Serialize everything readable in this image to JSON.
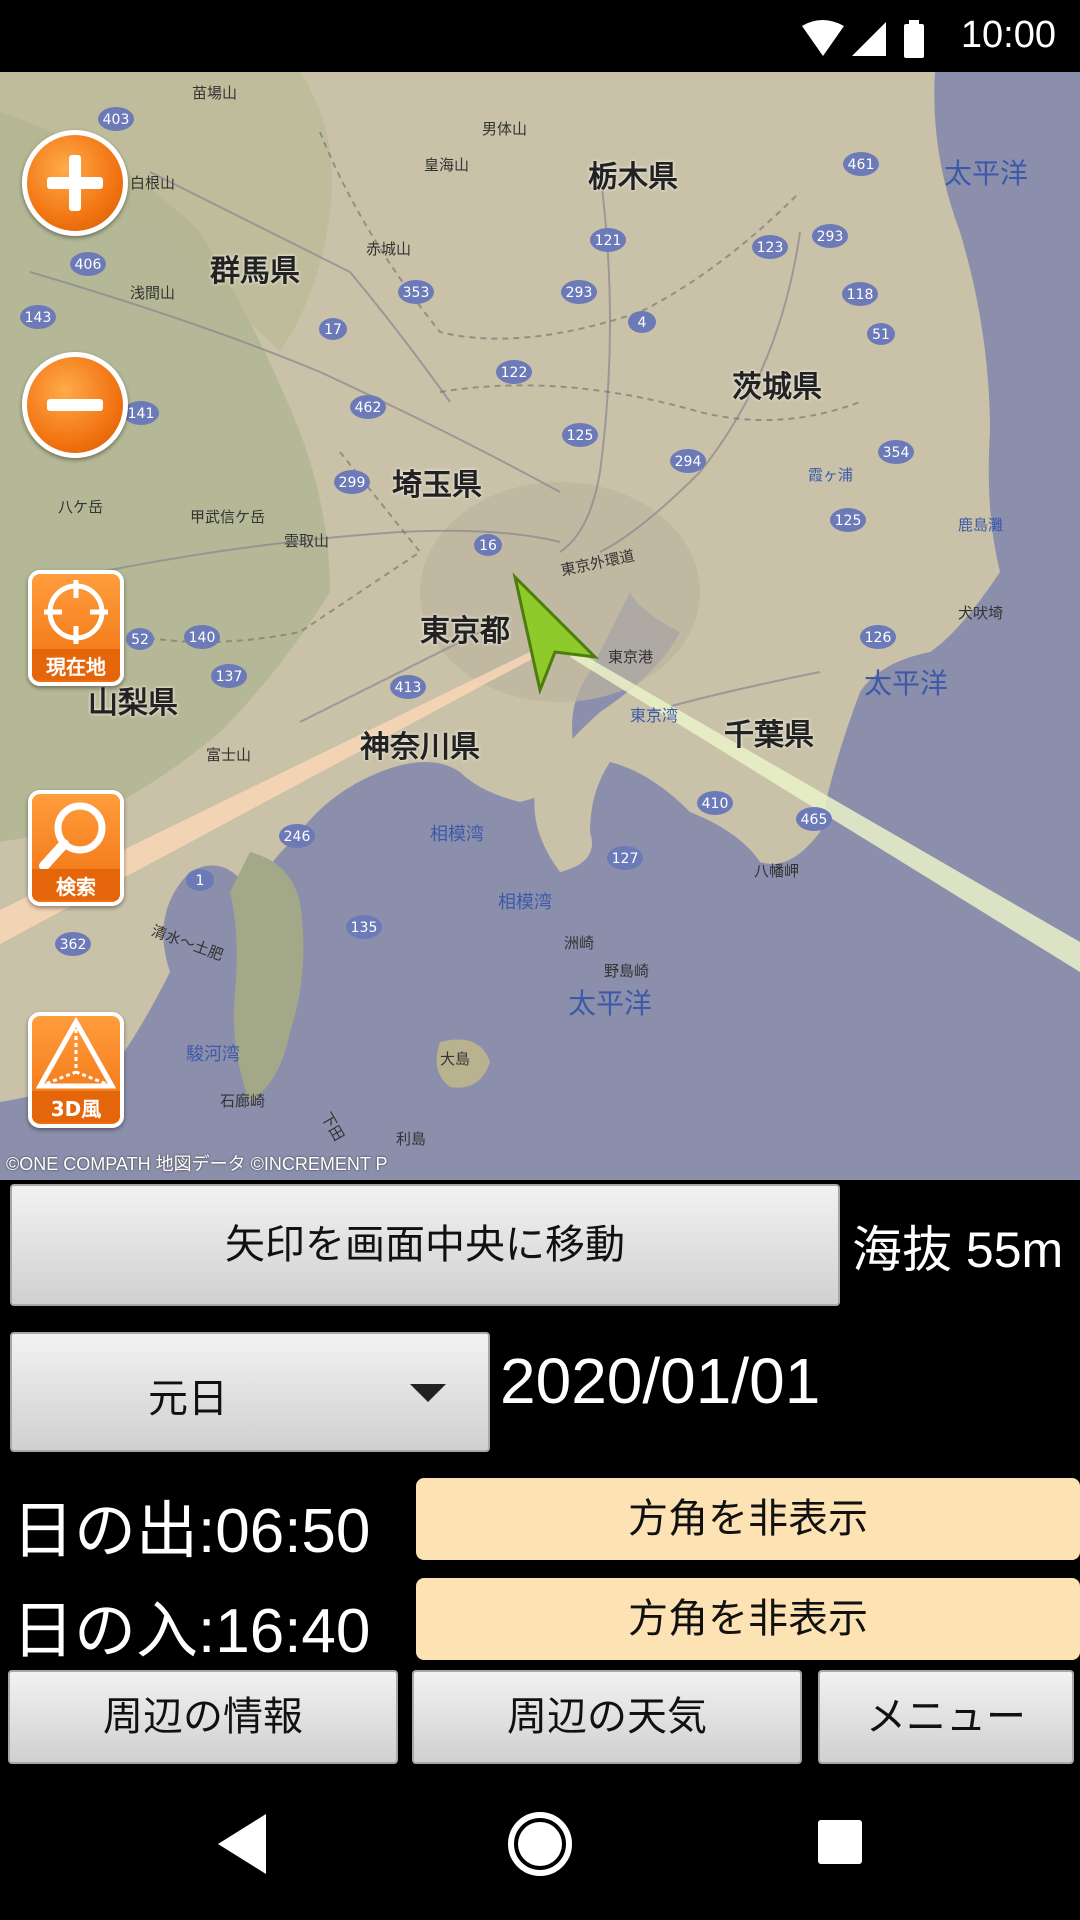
{
  "status_bar": {
    "time": "10:00",
    "icons": [
      "wifi-icon",
      "signal-icon",
      "battery-icon"
    ]
  },
  "map": {
    "copyright": "©ONE COMPATH 地図データ ©INCREMENT P",
    "prefectures": [
      "栃木県",
      "群馬県",
      "茨城県",
      "埼玉県",
      "東京都",
      "山梨県",
      "神奈川県",
      "千葉県"
    ],
    "seas": [
      "太平洋",
      "太平洋",
      "太平洋",
      "相模湾",
      "相模湾",
      "駿河湾",
      "東京湾"
    ],
    "places": [
      "苗場山",
      "男体山",
      "白根山",
      "皇海山",
      "赤城山",
      "浅間山",
      "甲武信ケ岳",
      "雲取山",
      "富士山",
      "八ケ岳",
      "霞ヶ浦",
      "鹿島灘",
      "犬吠埼",
      "八幡岬",
      "洲崎",
      "野島崎",
      "大島",
      "石廊崎",
      "利島",
      "東京港",
      "東京外環道",
      "清水～土肥",
      "下田"
    ],
    "route_numbers": [
      "403",
      "461",
      "293",
      "406",
      "121",
      "123",
      "353",
      "293",
      "118",
      "143",
      "17",
      "4",
      "51",
      "122",
      "462",
      "141",
      "125",
      "294",
      "354",
      "299",
      "16",
      "125",
      "52",
      "140",
      "126",
      "137",
      "413",
      "410",
      "465",
      "246",
      "127",
      "1",
      "135",
      "362"
    ],
    "buttons": {
      "zoom_in": "zoom-in",
      "zoom_out": "zoom-out",
      "current_location": "現在地",
      "search": "検索",
      "view_3d": "3D風"
    }
  },
  "controls": {
    "center_arrow_button": "矢印を画面中央に移動",
    "altitude": "海抜 55m",
    "holiday_select": "元日",
    "date": "2020/01/01",
    "sunrise_label": "日の出:06:50",
    "sunset_label": "日の入:16:40",
    "hide_direction_1": "方角を非表示",
    "hide_direction_2": "方角を非表示",
    "nearby_info": "周辺の情報",
    "nearby_weather": "周辺の天気",
    "menu": "メニュー"
  },
  "nav_bar": {
    "back": "back-icon",
    "home": "home-icon",
    "recents": "recents-icon"
  }
}
